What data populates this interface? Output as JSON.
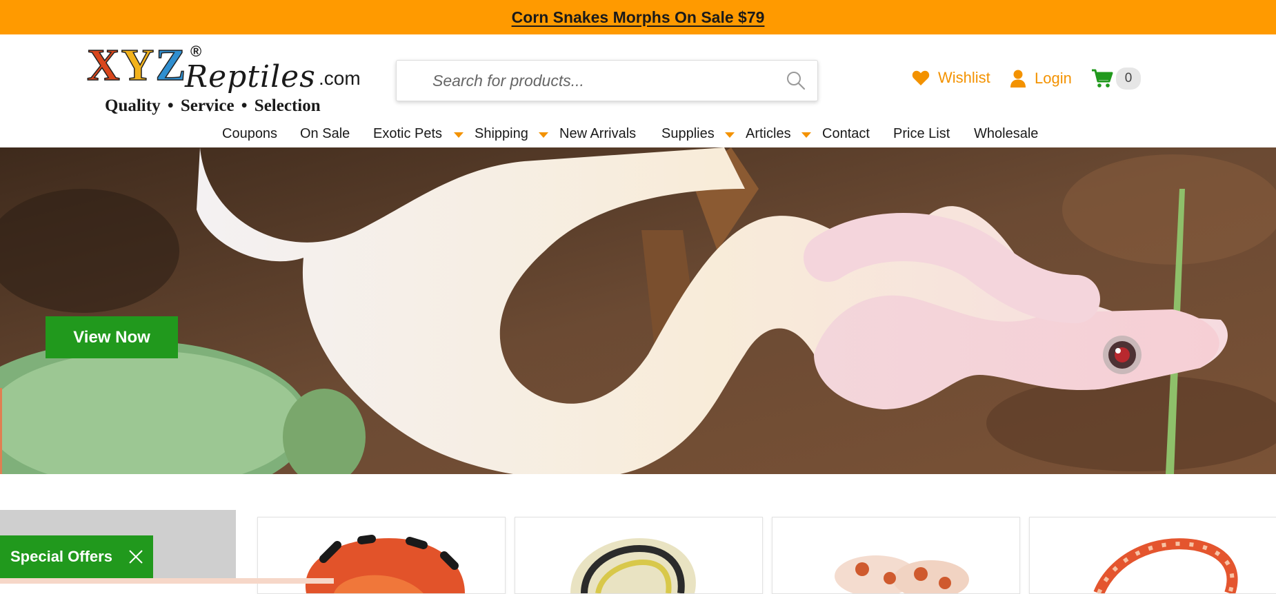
{
  "promo": {
    "text": "Corn Snakes Morphs On Sale $79"
  },
  "logo": {
    "xyz": [
      "X",
      "Y",
      "Z"
    ],
    "registered": "®",
    "reptiles": "Reptiles",
    "dotcom": ".com",
    "tagline": "Quality • Service • Selection"
  },
  "search": {
    "placeholder": "Search for products...",
    "icon": "search-icon"
  },
  "header_links": {
    "wishlist": {
      "label": "Wishlist",
      "icon": "heart-icon"
    },
    "login": {
      "label": "Login",
      "icon": "user-icon"
    },
    "cart": {
      "count": "0",
      "icon": "cart-icon"
    }
  },
  "nav": {
    "items": [
      {
        "label": "Coupons",
        "has_dropdown": false
      },
      {
        "label": "On Sale",
        "has_dropdown": false
      },
      {
        "label": "Exotic Pets",
        "has_dropdown": true
      },
      {
        "label": "Shipping",
        "has_dropdown": true
      },
      {
        "label": "New Arrivals",
        "has_dropdown": false
      },
      {
        "label": "Supplies",
        "has_dropdown": true
      },
      {
        "label": "Articles",
        "has_dropdown": true
      },
      {
        "label": "Contact",
        "has_dropdown": false
      },
      {
        "label": "Price List",
        "has_dropdown": false
      },
      {
        "label": "Wholesale",
        "has_dropdown": false
      }
    ]
  },
  "hero": {
    "button_label": "View Now"
  },
  "special_offers": {
    "label": "Special Offers",
    "close_icon": "close-icon"
  },
  "colors": {
    "accent_orange": "#ff9a00",
    "link_orange": "#f39200",
    "green": "#21991d",
    "cart_green": "#21991d"
  }
}
